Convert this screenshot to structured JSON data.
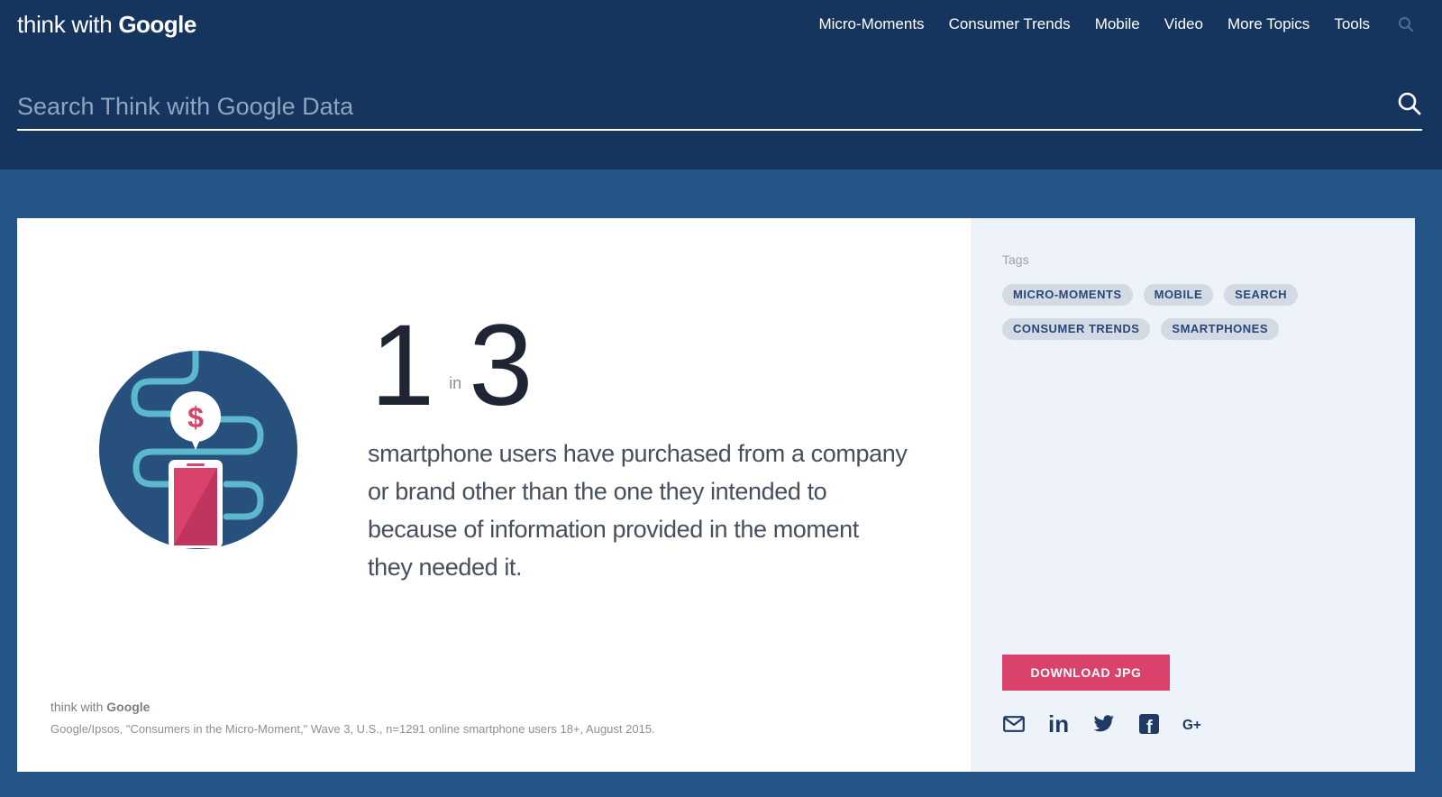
{
  "header": {
    "logo_prefix": "think with ",
    "logo_brand": "Google",
    "nav": [
      {
        "label": "Micro-Moments"
      },
      {
        "label": "Consumer Trends"
      },
      {
        "label": "Mobile"
      },
      {
        "label": "Video"
      },
      {
        "label": "More Topics"
      },
      {
        "label": "Tools"
      }
    ],
    "search_placeholder": "Search Think with Google Data"
  },
  "stat": {
    "numerator": "1",
    "connector": "in",
    "denominator": "3",
    "description": "smartphone users have purchased from a company or brand other than the one they intended to because of information provided in the moment they needed it."
  },
  "illustration": {
    "currency_symbol": "$"
  },
  "footer": {
    "logo_prefix": "think with ",
    "logo_brand": "Google",
    "citation": "Google/Ipsos, \"Consumers in the Micro-Moment,\" Wave 3, U.S., n=1291 online smartphone users 18+, August 2015."
  },
  "sidebar": {
    "tags_label": "Tags",
    "tags": [
      {
        "label": "MICRO-MOMENTS"
      },
      {
        "label": "MOBILE"
      },
      {
        "label": "SEARCH"
      },
      {
        "label": "CONSUMER TRENDS"
      },
      {
        "label": "SMARTPHONES"
      }
    ],
    "download_label": "DOWNLOAD JPG",
    "share": {
      "linkedin_text": "in",
      "facebook_text": "f",
      "googleplus_text": "G+"
    }
  },
  "colors": {
    "header_bg": "#15355e",
    "page_bg": "#255586",
    "accent": "#d8426b",
    "illustration_circle": "#27507d",
    "illustration_path": "#5cb8cc"
  }
}
